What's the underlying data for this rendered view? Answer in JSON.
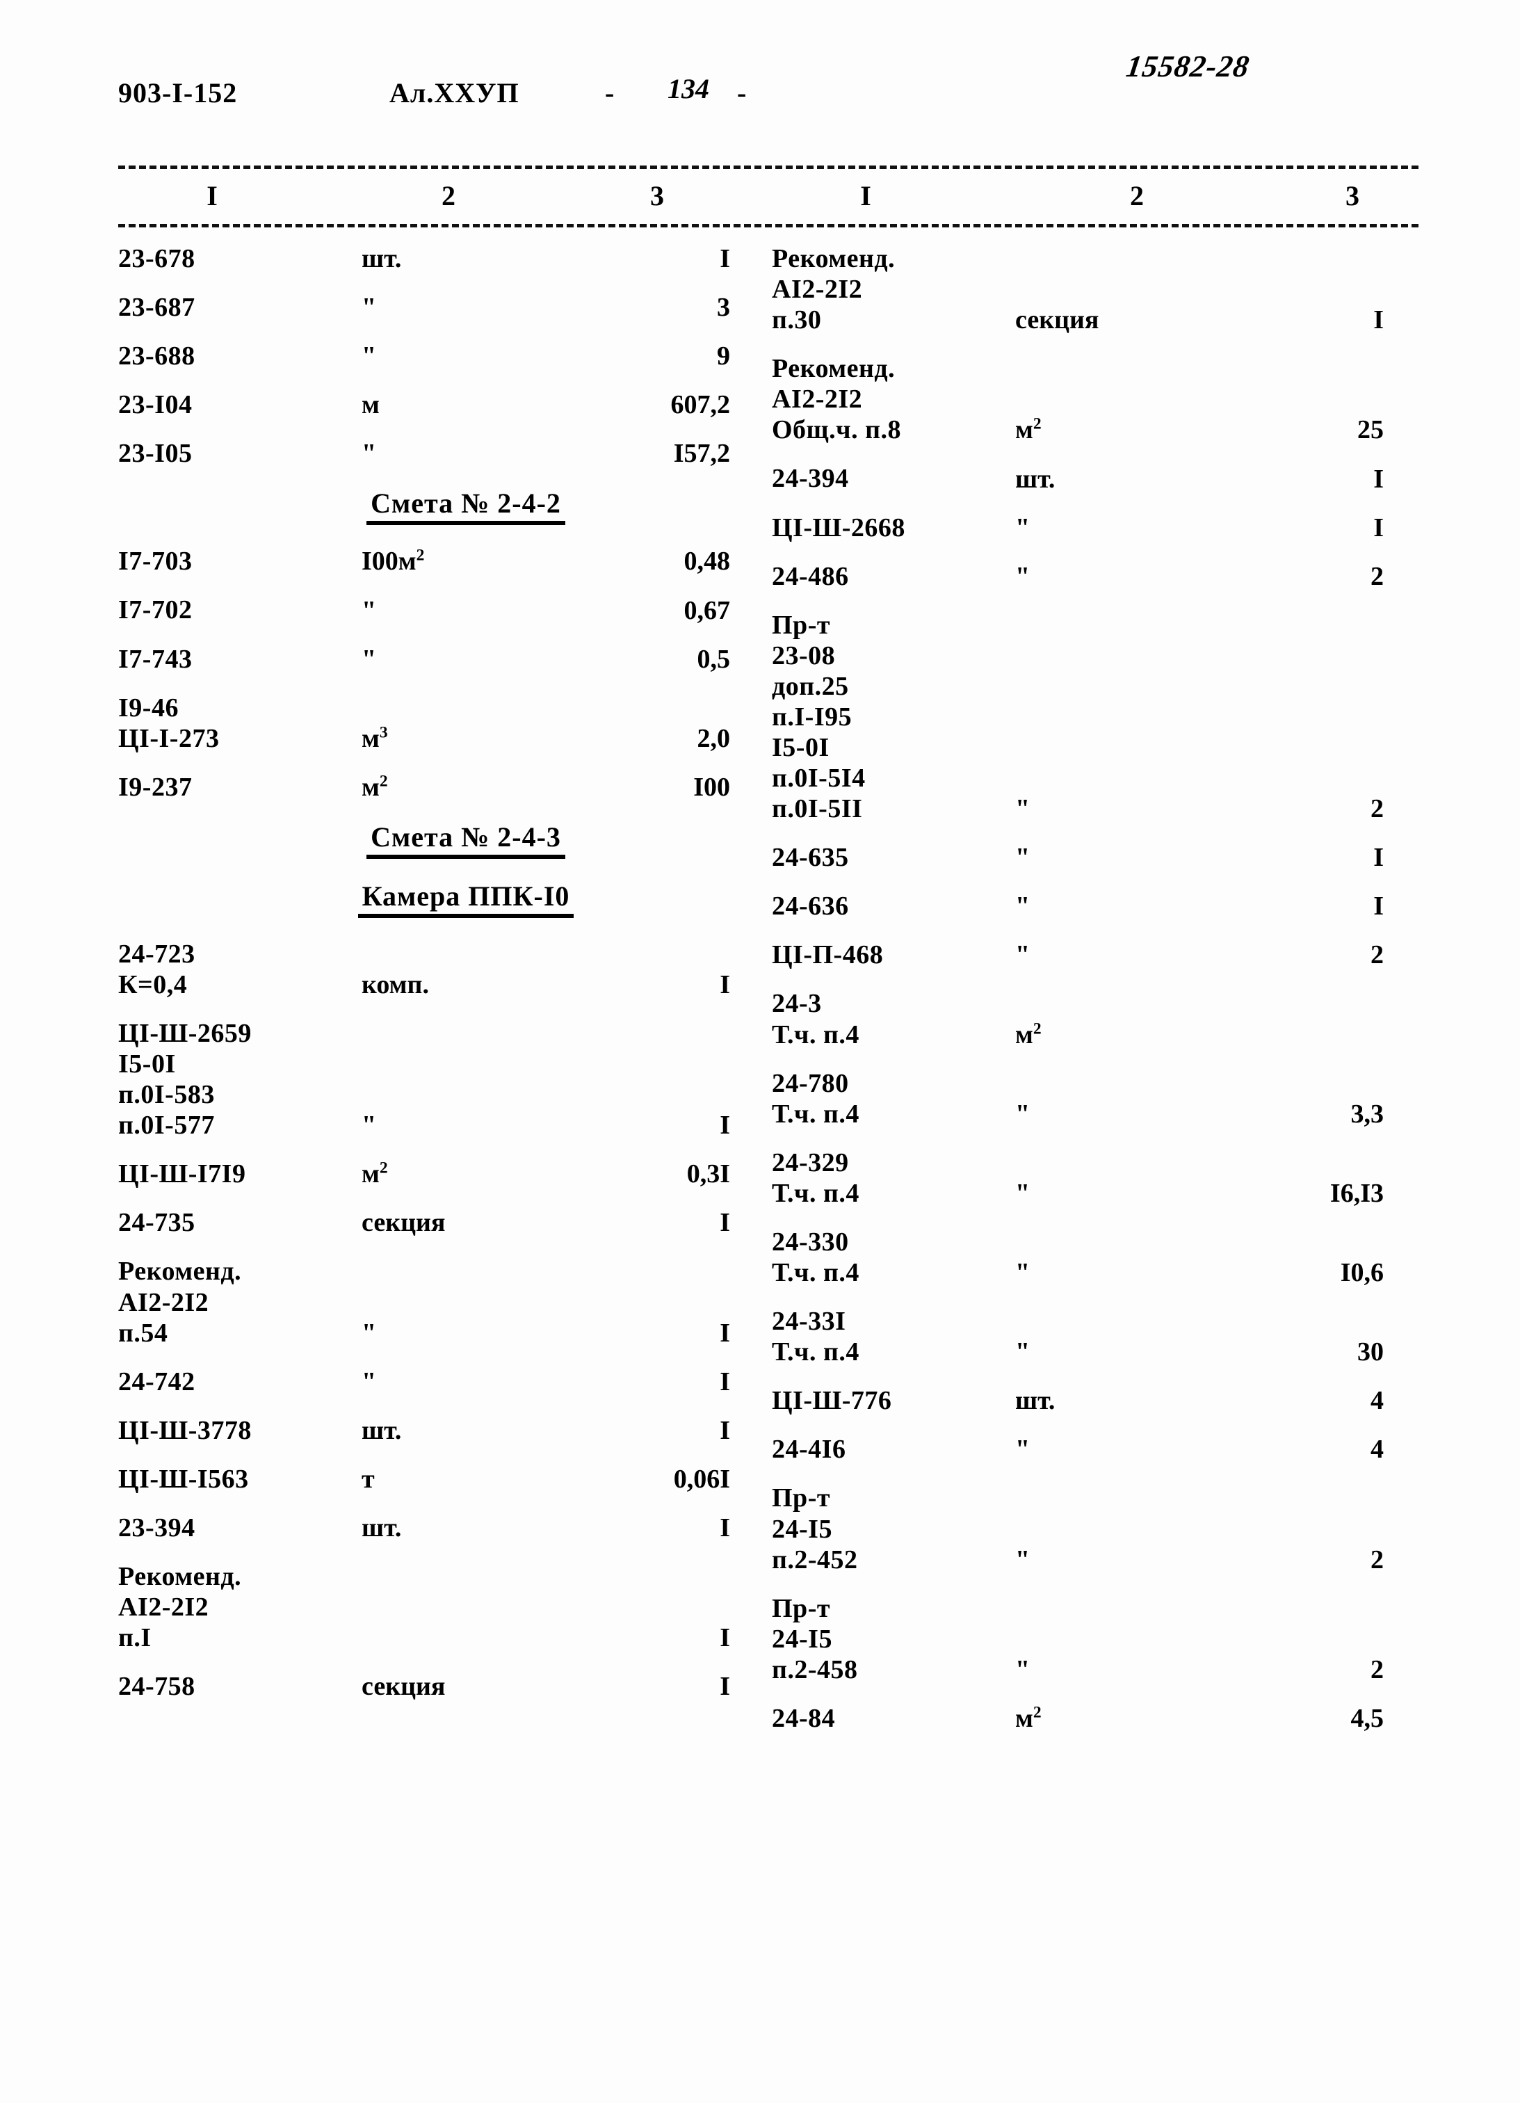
{
  "header": {
    "project_code": "903-I-152",
    "album": "Ал.XXУП",
    "dash_left": "-",
    "page_number": "134",
    "dash_right": "-",
    "archive_stamp": "15582-28"
  },
  "column_numbers": {
    "left": [
      "I",
      "2",
      "3"
    ],
    "right": [
      "I",
      "2",
      "3"
    ]
  },
  "left_column": [
    {
      "kind": "row",
      "code": "23-678",
      "unit": "шт.",
      "qty": "I"
    },
    {
      "kind": "row",
      "code": "23-687",
      "unit": "\"",
      "qty": "3"
    },
    {
      "kind": "row",
      "code": "23-688",
      "unit": "\"",
      "qty": "9"
    },
    {
      "kind": "row",
      "code": "23-I04",
      "unit": "м",
      "qty": "607,2"
    },
    {
      "kind": "row",
      "code": "23-I05",
      "unit": "\"",
      "qty": "I57,2"
    },
    {
      "kind": "heading",
      "text": "Смета № 2-4-2"
    },
    {
      "kind": "row",
      "code": "I7-703",
      "unit": "I00м",
      "unit_sup": "2",
      "qty": "0,48"
    },
    {
      "kind": "row",
      "code": "I7-702",
      "unit": "\"",
      "qty": "0,67"
    },
    {
      "kind": "row",
      "code": "I7-743",
      "unit": "\"",
      "qty": "0,5"
    },
    {
      "kind": "row",
      "code": "I9-46\nЦI-I-273",
      "unit": "м",
      "unit_sup": "3",
      "qty": "2,0"
    },
    {
      "kind": "row",
      "code": "I9-237",
      "unit": "м",
      "unit_sup": "2",
      "qty": "I00"
    },
    {
      "kind": "heading",
      "text": "Смета № 2-4-3"
    },
    {
      "kind": "heading",
      "text": "Камера ППК-I0"
    },
    {
      "kind": "row",
      "code": "24-723\nК=0,4",
      "unit": "комп.",
      "qty": "I"
    },
    {
      "kind": "row",
      "code": "ЦI-Ш-2659\nI5-0I\nп.0I-583\nп.0I-577",
      "unit": "\"",
      "qty": "I"
    },
    {
      "kind": "row",
      "code": "ЦI-Ш-I7I9",
      "unit": "м",
      "unit_sup": "2",
      "qty": "0,3I"
    },
    {
      "kind": "row",
      "code": "24-735",
      "unit": "секция",
      "qty": "I"
    },
    {
      "kind": "row",
      "code": "Рекоменд.\nАI2-2I2\nп.54",
      "unit": "\"",
      "qty": "I"
    },
    {
      "kind": "row",
      "code": "24-742",
      "unit": "\"",
      "qty": "I"
    },
    {
      "kind": "row",
      "code": "ЦI-Ш-3778",
      "unit": "шт.",
      "qty": "I"
    },
    {
      "kind": "row",
      "code": "ЦI-Ш-I563",
      "unit": "т",
      "qty": "0,06I"
    },
    {
      "kind": "row",
      "code": "23-394",
      "unit": "шт.",
      "qty": "I"
    },
    {
      "kind": "row",
      "code": "Рекоменд.\nАI2-2I2\nп.I",
      "unit": "",
      "qty": "I"
    },
    {
      "kind": "row",
      "code": "24-758",
      "unit": "секция",
      "qty": "I"
    }
  ],
  "right_column": [
    {
      "kind": "row",
      "code": "Рекоменд.\nАI2-2I2\nп.30",
      "unit": "секция",
      "qty": "I"
    },
    {
      "kind": "row",
      "code": "Рекоменд.\nАI2-2I2\nОбщ.ч.  п.8",
      "unit": "м",
      "unit_sup": "2",
      "qty": "25"
    },
    {
      "kind": "row",
      "code": "24-394",
      "unit": "шт.",
      "qty": "I"
    },
    {
      "kind": "row",
      "code": "ЦI-Ш-2668",
      "unit": "\"",
      "qty": "I"
    },
    {
      "kind": "row",
      "code": "24-486",
      "unit": "\"",
      "qty": "2"
    },
    {
      "kind": "row",
      "code": "Пр-т\n23-08\nдоп.25\nп.I-I95\nI5-0I\nп.0I-5I4\nп.0I-5II",
      "unit": "\"",
      "qty": "2"
    },
    {
      "kind": "row",
      "code": "24-635",
      "unit": "\"",
      "qty": "I"
    },
    {
      "kind": "row",
      "code": "24-636",
      "unit": "\"",
      "qty": "I"
    },
    {
      "kind": "row",
      "code": "ЦI-П-468",
      "unit": "\"",
      "qty": "2"
    },
    {
      "kind": "row",
      "code": "24-3\nТ.ч.  п.4",
      "unit": "м",
      "unit_sup": "2",
      "qty": ""
    },
    {
      "kind": "row",
      "code": "24-780\nТ.ч.  п.4",
      "unit": "\"",
      "qty": "3,3"
    },
    {
      "kind": "row",
      "code": "24-329\nТ.ч.  п.4",
      "unit": "\"",
      "qty": "I6,I3"
    },
    {
      "kind": "row",
      "code": "24-330\nТ.ч.  п.4",
      "unit": "\"",
      "qty": "I0,6"
    },
    {
      "kind": "row",
      "code": "24-33I\nТ.ч.  п.4",
      "unit": "\"",
      "qty": "30"
    },
    {
      "kind": "row",
      "code": "ЦI-Ш-776",
      "unit": "шт.",
      "qty": "4"
    },
    {
      "kind": "row",
      "code": "24-4I6",
      "unit": "\"",
      "qty": "4"
    },
    {
      "kind": "row",
      "code": "Пр-т\n24-I5\nп.2-452",
      "unit": "\"",
      "qty": "2"
    },
    {
      "kind": "row",
      "code": "Пр-т\n24-I5\nп.2-458",
      "unit": "\"",
      "qty": "2"
    },
    {
      "kind": "row",
      "code": "24-84",
      "unit": "м",
      "unit_sup": "2",
      "qty": "4,5"
    }
  ]
}
